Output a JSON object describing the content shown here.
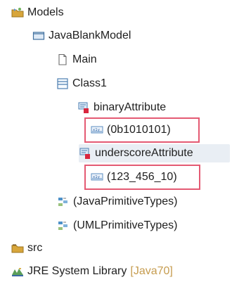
{
  "tree": {
    "models": {
      "label": "Models",
      "icon": "models-folder-icon"
    },
    "java_blank_model": {
      "label": "JavaBlankModel",
      "icon": "model-icon"
    },
    "main": {
      "label": "Main",
      "icon": "document-icon"
    },
    "class1": {
      "label": "Class1",
      "icon": "class-icon"
    },
    "binary_attribute": {
      "label": "binaryAttribute",
      "icon": "attribute-icon"
    },
    "binary_value": {
      "label": "(0b1010101)",
      "icon": "literal-value-icon"
    },
    "underscore_attribute": {
      "label": "underscoreAttribute",
      "icon": "attribute-icon",
      "selected": true
    },
    "underscore_value": {
      "label": "(123_456_10)",
      "icon": "literal-value-icon"
    },
    "java_primitive_types": {
      "label": "(JavaPrimitiveTypes)",
      "icon": "package-import-icon"
    },
    "uml_primitive_types": {
      "label": "(UMLPrimitiveTypes)",
      "icon": "package-import-icon"
    },
    "src": {
      "label": "src",
      "icon": "source-folder-icon"
    },
    "jre_system_library": {
      "label": "JRE System Library",
      "suffix": "[Java70]",
      "icon": "library-icon"
    }
  },
  "colors": {
    "highlight_border": "#e45a73",
    "selected_background": "#e9eef4",
    "decorator_text": "#c69c4f"
  }
}
